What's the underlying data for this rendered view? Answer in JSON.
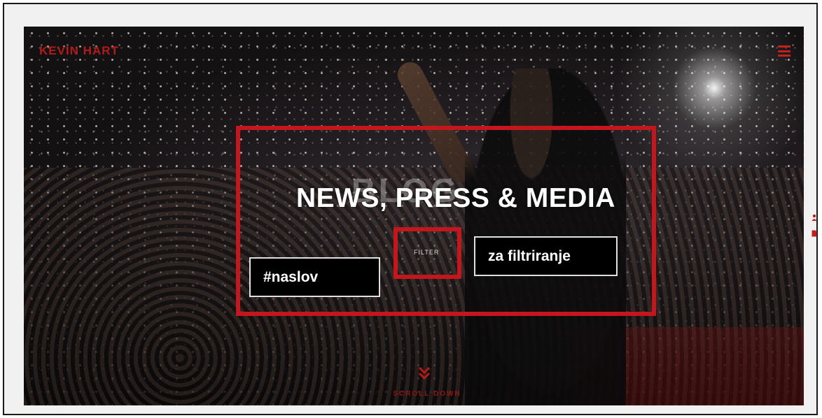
{
  "site": {
    "logo": "KEVIN HART",
    "menu_icon": "hamburger-menu-icon"
  },
  "hero": {
    "ghost_title": "BLOG",
    "title": "NEWS, PRESS & MEDIA",
    "filter_label": "FILTER",
    "scroll_label": "SCROLL DOWN",
    "scroll_icon": "double-chevron-down-icon"
  },
  "side_icons": [
    "user-icon",
    "document-icon"
  ],
  "annotations": {
    "title_label": "#naslov",
    "filter_label": "za filtriranje"
  },
  "colors": {
    "brand_red": "#b31b1b",
    "highlight_red": "#c4161c",
    "annotation_bg": "#000000",
    "annotation_text": "#ffffff"
  }
}
